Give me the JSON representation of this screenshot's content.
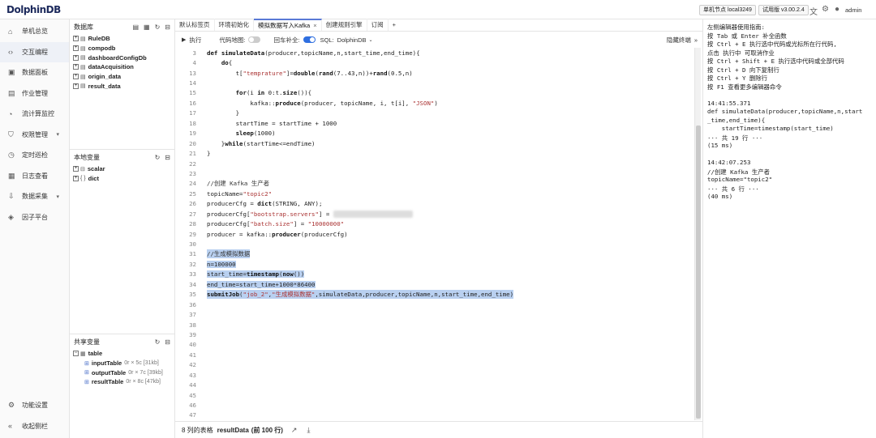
{
  "app": {
    "logo": "DolphinDB"
  },
  "header": {
    "node_badge": "单机节点 local3249",
    "version_badge": "试用版 v3.00.2.4",
    "user": "admin"
  },
  "nav": {
    "items": [
      {
        "label": "单机总览",
        "icon": "home-icon",
        "glyph": "⌂"
      },
      {
        "label": "交互编程",
        "icon": "code-icon",
        "glyph": "‹›"
      },
      {
        "label": "数据面板",
        "icon": "dashboard-icon",
        "glyph": "▣"
      },
      {
        "label": "作业管理",
        "icon": "job-icon",
        "glyph": "▤"
      },
      {
        "label": "流计算监控",
        "icon": "monitor-icon",
        "glyph": "◔"
      },
      {
        "label": "权限管理",
        "icon": "shield-icon",
        "glyph": "⛉"
      },
      {
        "label": "定时巡检",
        "icon": "clock-icon",
        "glyph": "◷"
      },
      {
        "label": "日志查看",
        "icon": "log-icon",
        "glyph": "▦"
      },
      {
        "label": "数据采集",
        "icon": "collect-icon",
        "glyph": "⇩"
      },
      {
        "label": "因子平台",
        "icon": "factor-icon",
        "glyph": "◈"
      }
    ],
    "settings": "功能设置",
    "collapse": "收起侧栏"
  },
  "db_panel": {
    "title": "数据库",
    "items": [
      "RuleDB",
      "compodb",
      "dashboardConfigDb",
      "dataAcquisition",
      "origin_data",
      "result_data"
    ]
  },
  "local_panel": {
    "title": "本地变量",
    "items": [
      {
        "name": "scalar",
        "glyph": "⊟"
      },
      {
        "name": "dict",
        "glyph": "{ }"
      }
    ]
  },
  "shared_panel": {
    "title": "共享变量",
    "group": "table",
    "items": [
      {
        "name": "inputTable",
        "meta": "0r × 5c [31kb]"
      },
      {
        "name": "outputTable",
        "meta": "0r × 7c [39kb]"
      },
      {
        "name": "resultTable",
        "meta": "0r × 8c [47kb]"
      }
    ]
  },
  "tabs": [
    {
      "label": "默认标签页",
      "active": false,
      "close": false
    },
    {
      "label": "环境初始化",
      "active": false,
      "close": false
    },
    {
      "label": "模拟数据写入Kafka",
      "active": true,
      "close": true
    },
    {
      "label": "创建规则引擎",
      "active": false,
      "close": false
    },
    {
      "label": "订阅",
      "active": false,
      "close": false
    }
  ],
  "toolbar": {
    "run": "执行",
    "minimap": "代码地图:",
    "autocomplete": "回车补全:",
    "sql": "SQL:",
    "sql_value": "DolphinDB",
    "hide_output": "隐藏终端"
  },
  "editor": {
    "lines": [
      {
        "n": "3",
        "t": "def simulateData(producer,topicName,n,start_time,end_time){",
        "sel": false
      },
      {
        "n": "4",
        "t": "    do{",
        "sel": false
      },
      {
        "n": "13",
        "t": "        t[\"temprature\"]=double(rand(7..43,n))+rand(0.5,n)",
        "sel": false
      },
      {
        "n": "14",
        "t": "",
        "sel": false
      },
      {
        "n": "15",
        "t": "        for(i in 0:t.size()){",
        "sel": false
      },
      {
        "n": "16",
        "t": "            kafka::produce(producer, topicName, i, t[i], \"JSON\")",
        "sel": false
      },
      {
        "n": "17",
        "t": "        }",
        "sel": false
      },
      {
        "n": "18",
        "t": "        startTime = startTime + 1000",
        "sel": false
      },
      {
        "n": "19",
        "t": "        sleep(1000)",
        "sel": false
      },
      {
        "n": "20",
        "t": "    }while(startTime<=endTime)",
        "sel": false
      },
      {
        "n": "21",
        "t": "}",
        "sel": false
      },
      {
        "n": "22",
        "t": "",
        "sel": false
      },
      {
        "n": "23",
        "t": "",
        "sel": false
      },
      {
        "n": "24",
        "t": "//创建 Kafka 生产者",
        "sel": false
      },
      {
        "n": "25",
        "t": "topicName=\"topic2\"",
        "sel": false
      },
      {
        "n": "26",
        "t": "producerCfg = dict(STRING, ANY);",
        "sel": false
      },
      {
        "n": "27",
        "t": "producerCfg[\"bootstrap.servers\"] = ",
        "sel": false,
        "blur": "\"192.168.100.100:9092\""
      },
      {
        "n": "28",
        "t": "producerCfg[\"batch.size\"] = \"10000000\"",
        "sel": false
      },
      {
        "n": "29",
        "t": "producer = kafka::producer(producerCfg)",
        "sel": false
      },
      {
        "n": "30",
        "t": "",
        "sel": false
      },
      {
        "n": "31",
        "t": "//生成模拟数据",
        "sel": true
      },
      {
        "n": "32",
        "t": "n=100000",
        "sel": true
      },
      {
        "n": "33",
        "t": "start_time=timestamp(now())",
        "sel": true
      },
      {
        "n": "34",
        "t": "end_time=start_time+1000*86400",
        "sel": true
      },
      {
        "n": "35",
        "t": "submitJob(\"job_2\",\"生成模拟数据\",simulateData,producer,topicName,n,start_time,end_time)",
        "sel": true
      },
      {
        "n": "36",
        "t": "",
        "sel": false
      },
      {
        "n": "37",
        "t": "",
        "sel": false
      },
      {
        "n": "38",
        "t": "",
        "sel": false
      },
      {
        "n": "39",
        "t": "",
        "sel": false
      },
      {
        "n": "40",
        "t": "",
        "sel": false
      },
      {
        "n": "41",
        "t": "",
        "sel": false
      },
      {
        "n": "42",
        "t": "",
        "sel": false
      },
      {
        "n": "43",
        "t": "",
        "sel": false
      },
      {
        "n": "44",
        "t": "",
        "sel": false
      },
      {
        "n": "45",
        "t": "",
        "sel": false
      },
      {
        "n": "46",
        "t": "",
        "sel": false
      },
      {
        "n": "47",
        "t": "",
        "sel": false
      }
    ]
  },
  "status": {
    "prefix": "8 列的表格",
    "name": "resultData",
    "rows": "(前 100 行)"
  },
  "terminal": {
    "lines": [
      "左侧编辑器使用指南:",
      "按 Tab 或 Enter 补全函数",
      "按 Ctrl + E 执行选中代码或光标所在行代码,",
      "点击 执行中 可取消作业",
      "按 Ctrl + Shift + E 执行选中代码或全部代码",
      "按 Ctrl + D 向下复制行",
      "按 Ctrl + Y 删除行",
      "按 F1 查看更多编辑器命令",
      "",
      "14:41:55.371",
      "def simulateData(producer,topicName,n,start",
      "_time,end_time){",
      "    startTime=timestamp(start_time)",
      "··· 共 19 行 ···",
      "(15 ms)",
      "",
      "14:42:07.253",
      "//创建 Kafka 生产者",
      "topicName=\"topic2\"",
      "··· 共 6 行 ···",
      "(40 ms)"
    ]
  }
}
